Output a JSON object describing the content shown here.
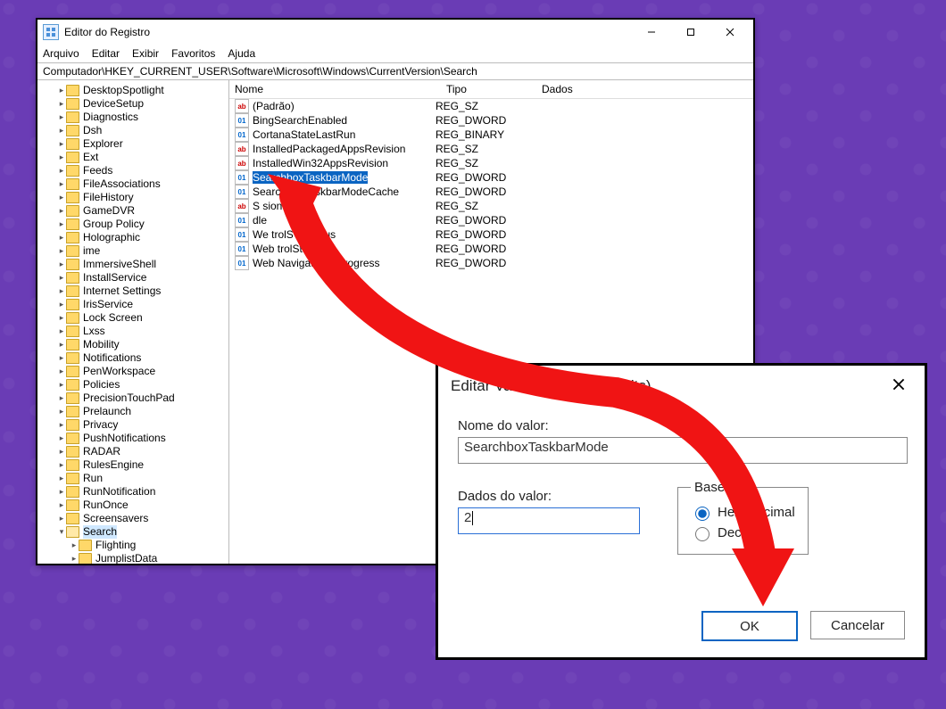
{
  "window": {
    "title": "Editor do Registro",
    "menu": [
      "Arquivo",
      "Editar",
      "Exibir",
      "Favoritos",
      "Ajuda"
    ],
    "address": "Computador\\HKEY_CURRENT_USER\\Software\\Microsoft\\Windows\\CurrentVersion\\Search"
  },
  "tree": {
    "items": [
      {
        "label": "DesktopSpotlight"
      },
      {
        "label": "DeviceSetup"
      },
      {
        "label": "Diagnostics"
      },
      {
        "label": "Dsh"
      },
      {
        "label": "Explorer"
      },
      {
        "label": "Ext"
      },
      {
        "label": "Feeds"
      },
      {
        "label": "FileAssociations"
      },
      {
        "label": "FileHistory"
      },
      {
        "label": "GameDVR"
      },
      {
        "label": "Group Policy"
      },
      {
        "label": "Holographic"
      },
      {
        "label": "ime"
      },
      {
        "label": "ImmersiveShell"
      },
      {
        "label": "InstallService"
      },
      {
        "label": "Internet Settings"
      },
      {
        "label": "IrisService"
      },
      {
        "label": "Lock Screen"
      },
      {
        "label": "Lxss"
      },
      {
        "label": "Mobility"
      },
      {
        "label": "Notifications"
      },
      {
        "label": "PenWorkspace"
      },
      {
        "label": "Policies"
      },
      {
        "label": "PrecisionTouchPad"
      },
      {
        "label": "Prelaunch"
      },
      {
        "label": "Privacy"
      },
      {
        "label": "PushNotifications"
      },
      {
        "label": "RADAR"
      },
      {
        "label": "RulesEngine"
      },
      {
        "label": "Run"
      },
      {
        "label": "RunNotification"
      },
      {
        "label": "RunOnce"
      },
      {
        "label": "Screensavers"
      }
    ],
    "search_label": "Search",
    "search_children": [
      {
        "label": "Flighting"
      },
      {
        "label": "JumplistData"
      }
    ]
  },
  "values": {
    "headers": {
      "nome": "Nome",
      "tipo": "Tipo",
      "dados": "Dados"
    },
    "rows": [
      {
        "icon": "str",
        "name": "(Padrão)",
        "type": "REG_SZ",
        "data": "",
        "sel": false
      },
      {
        "icon": "num",
        "name": "BingSearchEnabled",
        "type": "REG_DWORD",
        "data": "",
        "sel": false
      },
      {
        "icon": "num",
        "name": "CortanaStateLastRun",
        "type": "REG_BINARY",
        "data": "",
        "sel": false
      },
      {
        "icon": "str",
        "name": "InstalledPackagedAppsRevision",
        "type": "REG_SZ",
        "data": "",
        "sel": false
      },
      {
        "icon": "str",
        "name": "InstalledWin32AppsRevision",
        "type": "REG_SZ",
        "data": "",
        "sel": false
      },
      {
        "icon": "num",
        "name": "SearchboxTaskbarMode",
        "type": "REG_DWORD",
        "data": "",
        "sel": true
      },
      {
        "icon": "num",
        "name": "SearchboxTaskbarModeCache",
        "type": "REG_DWORD",
        "data": "",
        "sel": false
      },
      {
        "icon": "str",
        "name": "S                  sion",
        "type": "REG_SZ",
        "data": "",
        "sel": false
      },
      {
        "icon": "num",
        "name": "                   dle",
        "type": "REG_DWORD",
        "data": "",
        "sel": false
      },
      {
        "icon": "num",
        "name": "We       trolS        ryStatus",
        "type": "REG_DWORD",
        "data": "",
        "sel": false
      },
      {
        "icon": "num",
        "name": "Web      trolStatus",
        "type": "REG_DWORD",
        "data": "",
        "sel": false
      },
      {
        "icon": "num",
        "name": "Web      NavigationInProgress",
        "type": "REG_DWORD",
        "data": "",
        "sel": false
      }
    ]
  },
  "dialog": {
    "title": "Editar Valor DWORD (32 bits)",
    "name_label": "Nome do valor:",
    "name_value": "SearchboxTaskbarMode",
    "data_label": "Dados do valor:",
    "data_value": "2",
    "base_label": "Base",
    "radio_hex": "Hexadecimal",
    "radio_dec": "Decimal",
    "radio_selected": "hex",
    "ok": "OK",
    "cancel": "Cancelar"
  },
  "annotation": {
    "arrow_color": "#f01414"
  }
}
